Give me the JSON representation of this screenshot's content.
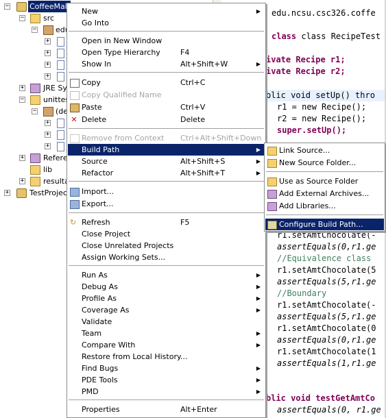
{
  "tree": {
    "rows": [
      {
        "label": "CoffeeMak"
      },
      {
        "label": "src"
      },
      {
        "label": "edu"
      },
      {
        "label": ""
      },
      {
        "label": ""
      },
      {
        "label": ""
      },
      {
        "label": "JRE Sys"
      },
      {
        "label": "unittest"
      },
      {
        "label": "(de"
      },
      {
        "label": ""
      },
      {
        "label": ""
      },
      {
        "label": ""
      },
      {
        "label": "Referen"
      },
      {
        "label": "lib"
      },
      {
        "label": "resultas"
      },
      {
        "label": "TestProject"
      }
    ]
  },
  "editor": {
    "lines": [
      "edu.ncsu.csc326.coffe",
      "class RecipeTest exte",
      "ivate Recipe r1;",
      "ivate Recipe r2;",
      "blic void setUp() thro",
      "r1 = new Recipe();",
      "r2 = new Recipe();",
      "super.setUp();",
      "r1.setAmtChocolate(-",
      "assertEquals(0,r1.ge",
      "//Equivalence class",
      "r1.setAmtChocolate(5",
      "assertEquals(5,r1.ge",
      "//Boundary",
      "r1.setAmtChocolate(-",
      "assertEquals(5,r1.ge",
      "r1.setAmtChocolate(0",
      "assertEquals(0,r1.ge",
      "r1.setAmtChocolate(1",
      "assertEquals(1,r1.ge",
      "blic void testGetAmtCo",
      "assertEquals(0, r1.ge"
    ]
  },
  "menu": {
    "new": "New",
    "go_into": "Go Into",
    "open_new_window": "Open in New Window",
    "open_type_hierarchy": "Open Type Hierarchy",
    "open_type_hierarchy_key": "F4",
    "show_in": "Show In",
    "show_in_key": "Alt+Shift+W",
    "copy": "Copy",
    "copy_key": "Ctrl+C",
    "copy_qualified": "Copy Qualified Name",
    "paste": "Paste",
    "paste_key": "Ctrl+V",
    "delete": "Delete",
    "delete_key": "Delete",
    "remove_context": "Remove from Context",
    "remove_context_key": "Ctrl+Alt+Shift+Down",
    "build_path": "Build Path",
    "source": "Source",
    "source_key": "Alt+Shift+S",
    "refactor": "Refactor",
    "refactor_key": "Alt+Shift+T",
    "import": "Import...",
    "export": "Export...",
    "refresh": "Refresh",
    "refresh_key": "F5",
    "close_project": "Close Project",
    "close_unrelated": "Close Unrelated Projects",
    "assign_working_sets": "Assign Working Sets...",
    "run_as": "Run As",
    "debug_as": "Debug As",
    "profile_as": "Profile As",
    "coverage_as": "Coverage As",
    "validate": "Validate",
    "team": "Team",
    "compare_with": "Compare With",
    "restore_history": "Restore from Local History...",
    "find_bugs": "Find Bugs",
    "pde_tools": "PDE Tools",
    "pmd": "PMD",
    "properties": "Properties",
    "properties_key": "Alt+Enter"
  },
  "submenu": {
    "link_source": "Link Source...",
    "new_source_folder": "New Source Folder...",
    "use_as_source": "Use as Source Folder",
    "add_external_archives": "Add External Archives...",
    "add_libraries": "Add Libraries...",
    "configure_build_path": "Configure Build Path..."
  },
  "colors": {
    "selection": "#0a246a",
    "keyword": "#7f0055",
    "comment": "#3f7f5f"
  }
}
